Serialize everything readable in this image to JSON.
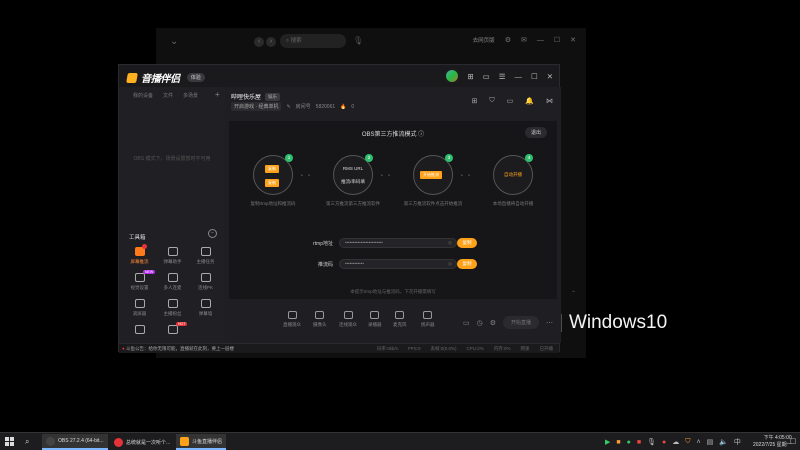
{
  "background_window": {
    "search_placeholder": "搜索",
    "right_label": "去网页版",
    "badge_count": "8"
  },
  "watermark": {
    "pipe": "|",
    "text": "Windows10"
  },
  "app": {
    "name": "音播伴侣",
    "badge": "体验",
    "room": {
      "title": "哔哩快乐屋",
      "tag": "娱乐",
      "category": "开启游戏 · 经典单机",
      "room_id_label": "房间号",
      "room_id": "5820061",
      "popularity": "0"
    },
    "sidebar": {
      "tabs": [
        "我的设备",
        "文件",
        "多场景"
      ],
      "empty_text": "OBS 模式下，场景设置暂时不可用",
      "tools_title": "工具箱",
      "tools": [
        {
          "label": "屏幕推流",
          "highlight": true,
          "badge": ""
        },
        {
          "label": "弹幕助手",
          "highlight": false,
          "badge": ""
        },
        {
          "label": "主播任务",
          "highlight": false,
          "badge": ""
        },
        {
          "label": "视觉设置",
          "highlight": false,
          "badge": "NEW"
        },
        {
          "label": "多人连麦",
          "highlight": false,
          "badge": ""
        },
        {
          "label": "连线PK",
          "highlight": false,
          "badge": ""
        },
        {
          "label": "滚屏器",
          "highlight": false,
          "badge": ""
        },
        {
          "label": "主播粉丝",
          "highlight": false,
          "badge": ""
        },
        {
          "label": "弹幕墙",
          "highlight": false,
          "badge": ""
        },
        {
          "label": "",
          "highlight": false,
          "badge": ""
        },
        {
          "label": "",
          "highlight": false,
          "badge": "HOT"
        }
      ]
    },
    "obs": {
      "title": "OBS第三方推流模式",
      "exit_label": "退出",
      "steps": [
        {
          "num": "1",
          "buttons": [
            "复制",
            "复制"
          ],
          "text": "",
          "desc": "复制rtmp地址和推流码"
        },
        {
          "num": "2",
          "buttons": [],
          "text": "RMS URL",
          "text2": "推流/串码填",
          "desc": "第三方推流第三方推流软件"
        },
        {
          "num": "3",
          "buttons": [
            "开始推流"
          ],
          "text": "",
          "desc": "第三方推流软件点击开始推流"
        },
        {
          "num": "4",
          "buttons": [],
          "text": "自动开播",
          "desc": "本场直播将自动开播"
        }
      ],
      "rtmp_label": "rtmp地址",
      "rtmp_value": "••••••••••••••••••••••••",
      "stream_label": "推流码",
      "stream_value": "••••••••••••",
      "copy_label": "复制",
      "hint": "本提示rtmp地址与推流码，下次开播需填写"
    },
    "bottom_tools": [
      "直播观众",
      "摄像头",
      "连线观众",
      "录播器",
      "麦克风",
      "扬声器"
    ],
    "start_live_label": "开始直播",
    "notice": "斗鱼公告：给你无限可能，直播就在此刻，要上一层楼",
    "stats": [
      "码率:0kb/s",
      "FPS:0",
      "丢帧:0(0.0%)",
      "CPU:2%",
      "内存:0%",
      "网速",
      "已开播"
    ]
  },
  "taskbar": {
    "tasks": [
      {
        "label": "OBS 27.2.4 (64-bit...",
        "active": true,
        "color": "#444444"
      },
      {
        "label": "总统就是一次听个...",
        "active": false,
        "color": "#e6333a"
      },
      {
        "label": "斗鱼直播伴侣",
        "active": true,
        "color": "#ffa21a"
      }
    ],
    "time": "下午 4:05:00",
    "date": "2022/7/25 星期一"
  },
  "colors": {
    "accent": "#ffa21a",
    "success": "#2fbf71",
    "danger": "#e6333a"
  }
}
